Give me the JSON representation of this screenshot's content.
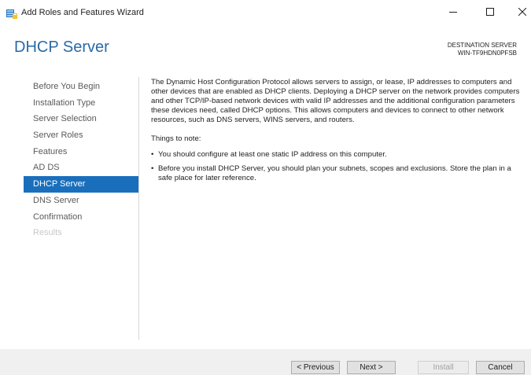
{
  "window": {
    "title": "Add Roles and Features Wizard"
  },
  "header": {
    "page_title": "DHCP Server",
    "destination_label": "DESTINATION SERVER",
    "destination_value": "WIN-TF9HDN0PFSB"
  },
  "nav": {
    "items": [
      {
        "label": "Before You Begin",
        "state": "normal"
      },
      {
        "label": "Installation Type",
        "state": "normal"
      },
      {
        "label": "Server Selection",
        "state": "normal"
      },
      {
        "label": "Server Roles",
        "state": "normal"
      },
      {
        "label": "Features",
        "state": "normal"
      },
      {
        "label": "AD DS",
        "state": "normal"
      },
      {
        "label": "DHCP Server",
        "state": "active"
      },
      {
        "label": "DNS Server",
        "state": "normal"
      },
      {
        "label": "Confirmation",
        "state": "normal"
      },
      {
        "label": "Results",
        "state": "disabled"
      }
    ]
  },
  "content": {
    "intro": "The Dynamic Host Configuration Protocol allows servers to assign, or lease, IP addresses to computers and other devices that are enabled as DHCP clients. Deploying a DHCP server on the network provides computers and other TCP/IP-based network devices with valid IP addresses and the additional configuration parameters these devices need, called DHCP options. This allows computers and devices to connect to other network resources, such as DNS servers, WINS servers, and routers.",
    "notes_heading": "Things to note:",
    "notes": [
      "You should configure at least one static IP address on this computer.",
      "Before you install DHCP Server, you should plan your subnets, scopes and exclusions. Store the plan in a safe place for later reference."
    ],
    "bullet_glyph": "•"
  },
  "footer": {
    "previous_label": "< Previous",
    "next_label": "Next >",
    "install_label": "Install",
    "cancel_label": "Cancel"
  },
  "icons": {
    "app": "server-manager-icon",
    "minimize": "minimize-icon",
    "maximize": "maximize-icon",
    "close": "close-icon"
  },
  "colors": {
    "heading_blue": "#2a6aa8",
    "selected_nav": "#1a6fbc",
    "footer_bg": "#f0f0f0"
  }
}
